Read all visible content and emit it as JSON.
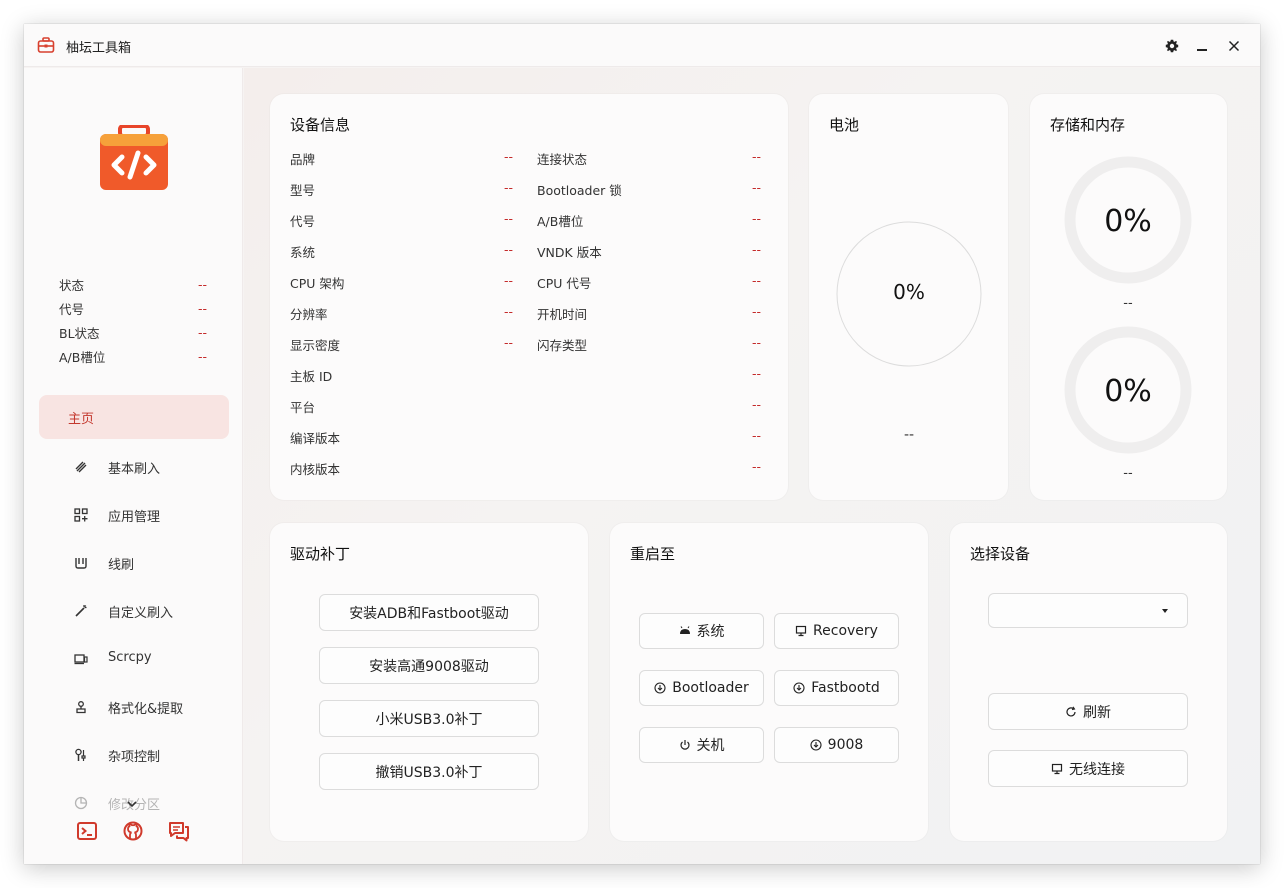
{
  "app": {
    "title": "柚坛工具箱"
  },
  "sidebar": {
    "status": [
      {
        "label": "状态",
        "value": "--"
      },
      {
        "label": "代号",
        "value": "--"
      },
      {
        "label": "BL状态",
        "value": "--"
      },
      {
        "label": "A/B槽位",
        "value": "--"
      }
    ],
    "nav": [
      {
        "label": "主页",
        "icon": "home-icon",
        "active": true
      },
      {
        "label": "基本刷入",
        "icon": "flash-icon"
      },
      {
        "label": "应用管理",
        "icon": "apps-icon"
      },
      {
        "label": "线刷",
        "icon": "usb-flash-icon"
      },
      {
        "label": "自定义刷入",
        "icon": "wand-icon"
      },
      {
        "label": "Scrcpy",
        "icon": "screen-mirror-icon"
      },
      {
        "label": "格式化&提取",
        "icon": "extract-icon"
      },
      {
        "label": "杂项控制",
        "icon": "tools-icon"
      },
      {
        "label": "修改分区",
        "icon": "partition-icon"
      }
    ]
  },
  "device_info": {
    "title": "设备信息",
    "left": [
      {
        "label": "品牌",
        "value": "--"
      },
      {
        "label": "型号",
        "value": "--"
      },
      {
        "label": "代号",
        "value": "--"
      },
      {
        "label": "系统",
        "value": "--"
      },
      {
        "label": "CPU 架构",
        "value": "--"
      },
      {
        "label": "分辨率",
        "value": "--"
      },
      {
        "label": "显示密度",
        "value": "--"
      },
      {
        "label": "主板 ID",
        "value": "--"
      },
      {
        "label": "平台",
        "value": "--"
      },
      {
        "label": "编译版本",
        "value": "--"
      },
      {
        "label": "内核版本",
        "value": "--"
      }
    ],
    "right": [
      {
        "label": "连接状态",
        "value": "--"
      },
      {
        "label": "Bootloader 锁",
        "value": "--"
      },
      {
        "label": "A/B槽位",
        "value": "--"
      },
      {
        "label": "VNDK 版本",
        "value": "--"
      },
      {
        "label": "CPU 代号",
        "value": "--"
      },
      {
        "label": "开机时间",
        "value": "--"
      },
      {
        "label": "闪存类型",
        "value": "--"
      }
    ]
  },
  "battery": {
    "title": "电池",
    "percent": "0%",
    "info": "--"
  },
  "storage": {
    "title": "存储和内存",
    "storage_percent": "0%",
    "storage_info": "--",
    "memory_percent": "0%",
    "memory_info": "--"
  },
  "driver": {
    "title": "驱动补丁",
    "buttons": [
      "安装ADB和Fastboot驱动",
      "安装高通9008驱动",
      "小米USB3.0补丁",
      "撤销USB3.0补丁"
    ]
  },
  "reboot": {
    "title": "重启至",
    "buttons": [
      {
        "label": "系统",
        "icon": "android-icon"
      },
      {
        "label": "Recovery",
        "icon": "monitor-icon"
      },
      {
        "label": "Bootloader",
        "icon": "download-circle-icon"
      },
      {
        "label": "Fastbootd",
        "icon": "download-circle-icon"
      },
      {
        "label": "关机",
        "icon": "power-icon"
      },
      {
        "label": "9008",
        "icon": "download-circle-icon"
      }
    ]
  },
  "select_device": {
    "title": "选择设备",
    "selected": "",
    "refresh_label": "刷新",
    "wireless_label": "无线连接"
  },
  "colors": {
    "accent": "#c4382e",
    "value_red": "#c42a2a",
    "active_bg": "#f8e4e2",
    "logo_orange": "#f2552c"
  }
}
